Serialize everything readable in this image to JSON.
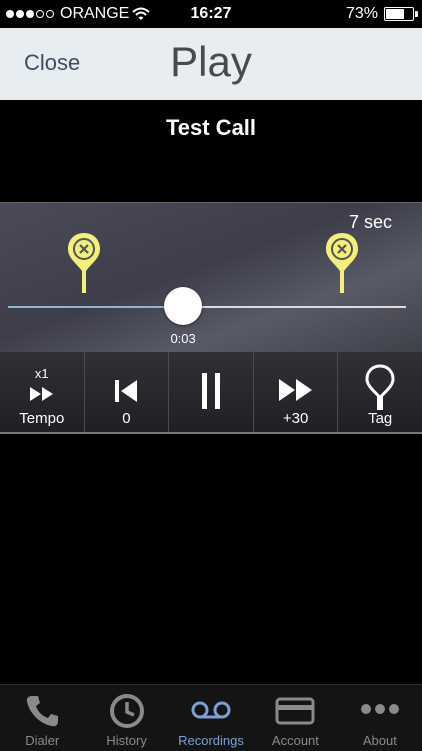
{
  "status_bar": {
    "carrier": "ORANGE",
    "time": "16:27",
    "battery": "73%",
    "battery_level": 0.73,
    "signal_bars": 3,
    "signal_total": 5
  },
  "nav": {
    "close_label": "Close",
    "title": "Play"
  },
  "recording": {
    "title": "Test Call",
    "duration": "7 sec",
    "position": "0:03",
    "progress": 0.44,
    "tag_positions": [
      0.19,
      0.84
    ]
  },
  "controls": {
    "tempo_multiplier": "x1",
    "tempo_label": "Tempo",
    "back_label": "0",
    "forward_label": "+30",
    "tag_label": "Tag"
  },
  "tabs": [
    {
      "label": "Dialer",
      "icon": "phone-icon"
    },
    {
      "label": "History",
      "icon": "clock-icon"
    },
    {
      "label": "Recordings",
      "icon": "voicemail-icon",
      "active": true
    },
    {
      "label": "Account",
      "icon": "credit-card-icon"
    },
    {
      "label": "About",
      "icon": "more-icon"
    }
  ],
  "colors": {
    "accent": "#7aa0d6",
    "tag_pin": "#f2f07a",
    "nav_bg": "#e8edf1"
  }
}
